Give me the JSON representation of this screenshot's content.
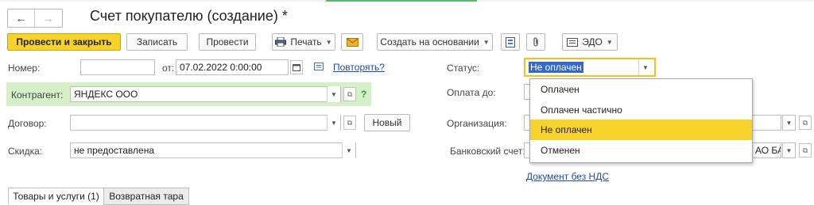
{
  "window": {
    "title": "Счет покупателю (создание) *",
    "nav_back": "←",
    "nav_forward": "→"
  },
  "toolbar": {
    "post_close_label": "Провести и закрыть",
    "save_label": "Записать",
    "post_label": "Провести",
    "print_label": "Печать",
    "create_based_label": "Создать на основании",
    "edo_label": "ЭДО"
  },
  "form": {
    "number_label": "Номер:",
    "number_value": "",
    "date_from_label": "от:",
    "date_value": "07.02.2022  0:00:00",
    "repeat_link": "Повторять?",
    "counterparty_label": "Контрагент:",
    "counterparty_value": "ЯНДЕКС ООО",
    "help_mark": "?",
    "contract_label": "Договор:",
    "contract_value": "",
    "new_button": "Новый",
    "discount_label": "Скидка:",
    "discount_value": "не предоставлена",
    "status_label": "Статус:",
    "status_value": "Не оплачен",
    "pay_until_label": "Оплата до:",
    "organization_label": "Организация:",
    "bank_account_label": "Банковский счет:",
    "bank_account_value_partial": "АО БА",
    "vat_link": "Документ без НДС"
  },
  "status_menu": {
    "options": [
      "Оплачен",
      "Оплачен частично",
      "Не оплачен",
      "Отменен"
    ],
    "selected_index": 2
  },
  "tabs": [
    {
      "label": "Товары и услуги (1)"
    },
    {
      "label": "Возвратная тара"
    }
  ],
  "colors": {
    "accent": "#f7d22b",
    "link": "#1f4aa8",
    "highlight_band": "#d6efc8"
  }
}
